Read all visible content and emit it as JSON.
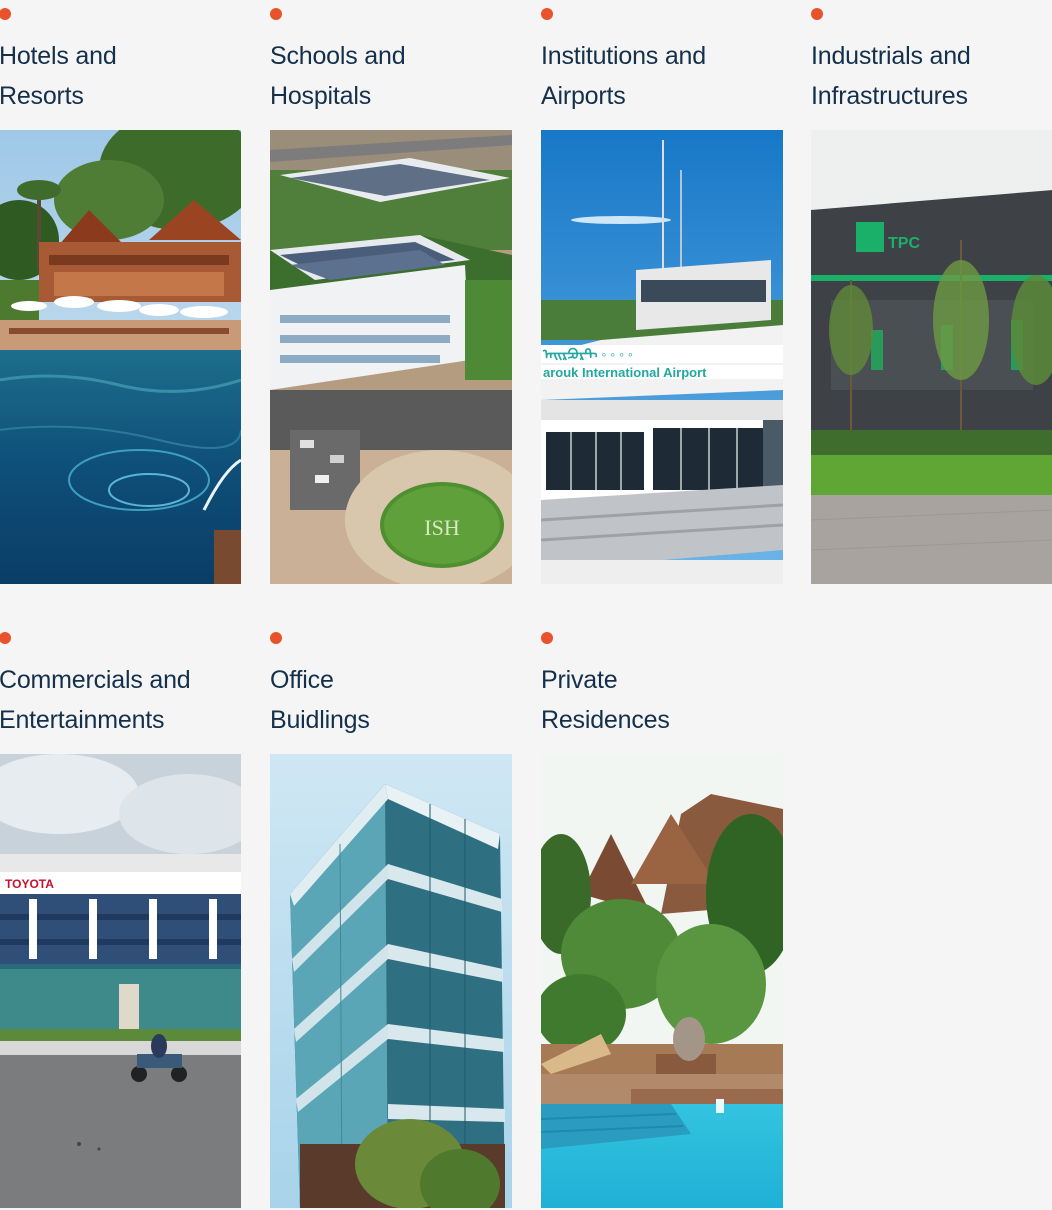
{
  "categories": [
    {
      "line1": "Hotels and",
      "line2": "Resorts",
      "image": "resort-pool-photo"
    },
    {
      "line1": "Schools and",
      "line2": "Hospitals",
      "image": "hospital-aerial-photo"
    },
    {
      "line1": "Institutions and",
      "line2": "Airports",
      "image": "airport-tower-photo"
    },
    {
      "line1": "Industrials and",
      "line2": "Infrastructures",
      "image": "factory-building-photo"
    },
    {
      "line1": "Commercials and",
      "line2": "Entertainments",
      "image": "car-showroom-photo"
    },
    {
      "line1": "Office",
      "line2": "Buidlings",
      "image": "office-tower-photo"
    },
    {
      "line1": "Private",
      "line2": "Residences",
      "image": "villa-pool-photo"
    }
  ],
  "photo_text": {
    "factory_sign": "TPC",
    "airport_sign_latin": "arouk International Airport",
    "showroom_sign": "TOYOTA",
    "lawn_logo": "ISH"
  },
  "colors": {
    "accent_dot": "#e8532b",
    "heading_text": "#14304a",
    "background": "#f5f5f5"
  }
}
